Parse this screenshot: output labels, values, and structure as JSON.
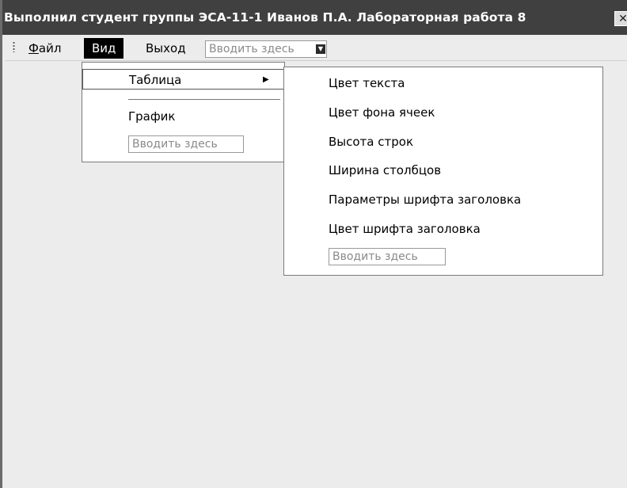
{
  "window": {
    "title": "Выполнил студент группы ЭСА-11-1 Иванов П.А. Лабораторная работа 8",
    "close_glyph": "✕"
  },
  "menubar": {
    "items": [
      {
        "label": "Файл",
        "underline": "Ф",
        "rest": "айл"
      },
      {
        "label": "Вид"
      },
      {
        "label": "Выход"
      }
    ],
    "type_here": "Вводить здесь"
  },
  "view_menu": {
    "items": [
      {
        "label": "Таблица",
        "has_submenu": true,
        "highlighted": true
      },
      {
        "label": "График"
      }
    ],
    "type_here": "Вводить здесь"
  },
  "table_submenu": {
    "items": [
      "Цвет текста",
      "Цвет фона ячеек",
      "Высота строк",
      "Ширина столбцов",
      "Параметры шрифта заголовка",
      "Цвет шрифта заголовка"
    ],
    "type_here": "Вводить здесь"
  },
  "icons": {
    "submenu_arrow": "▶",
    "dropdown_arrow": "▼"
  }
}
